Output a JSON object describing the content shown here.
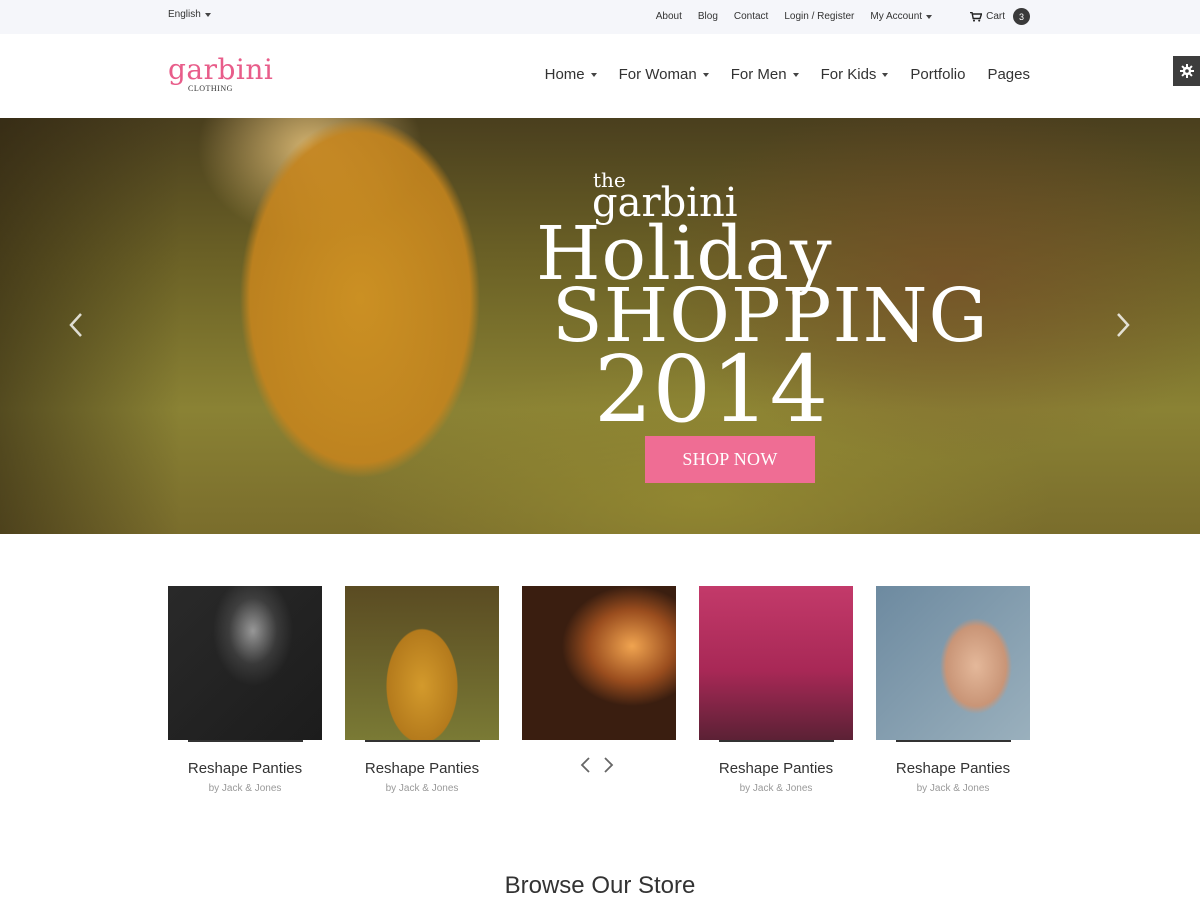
{
  "topbar": {
    "language": "English",
    "links": [
      "About",
      "Blog",
      "Contact",
      "Login / Register",
      "My Account"
    ],
    "cart_label": "Cart",
    "cart_count": "3"
  },
  "logo": {
    "name": "garbini",
    "tagline": "CLOTHING",
    "color": "#e85d8a"
  },
  "nav": [
    "Home",
    "For Woman",
    "For Men",
    "For Kids",
    "Portfolio",
    "Pages"
  ],
  "hero": {
    "line_the": "the",
    "line_brand": "garbini",
    "line_holiday": "Holiday",
    "line_shopping": "SHOPPING",
    "line_year": "2014",
    "cta": "SHOP NOW",
    "cta_color": "#ef6d94"
  },
  "products": [
    {
      "name": "Reshape Panties",
      "brand": "by Jack & Jones"
    },
    {
      "name": "Reshape Panties",
      "brand": "by Jack & Jones"
    },
    {
      "name": "",
      "brand": ""
    },
    {
      "name": "Reshape Panties",
      "brand": "by Jack & Jones"
    },
    {
      "name": "Reshape Panties",
      "brand": "by Jack & Jones"
    }
  ],
  "section_title": "Browse Our Store",
  "icons": [
    "caret-down-icon",
    "cart-icon",
    "gear-icon",
    "chevron-left-icon",
    "chevron-right-icon"
  ]
}
